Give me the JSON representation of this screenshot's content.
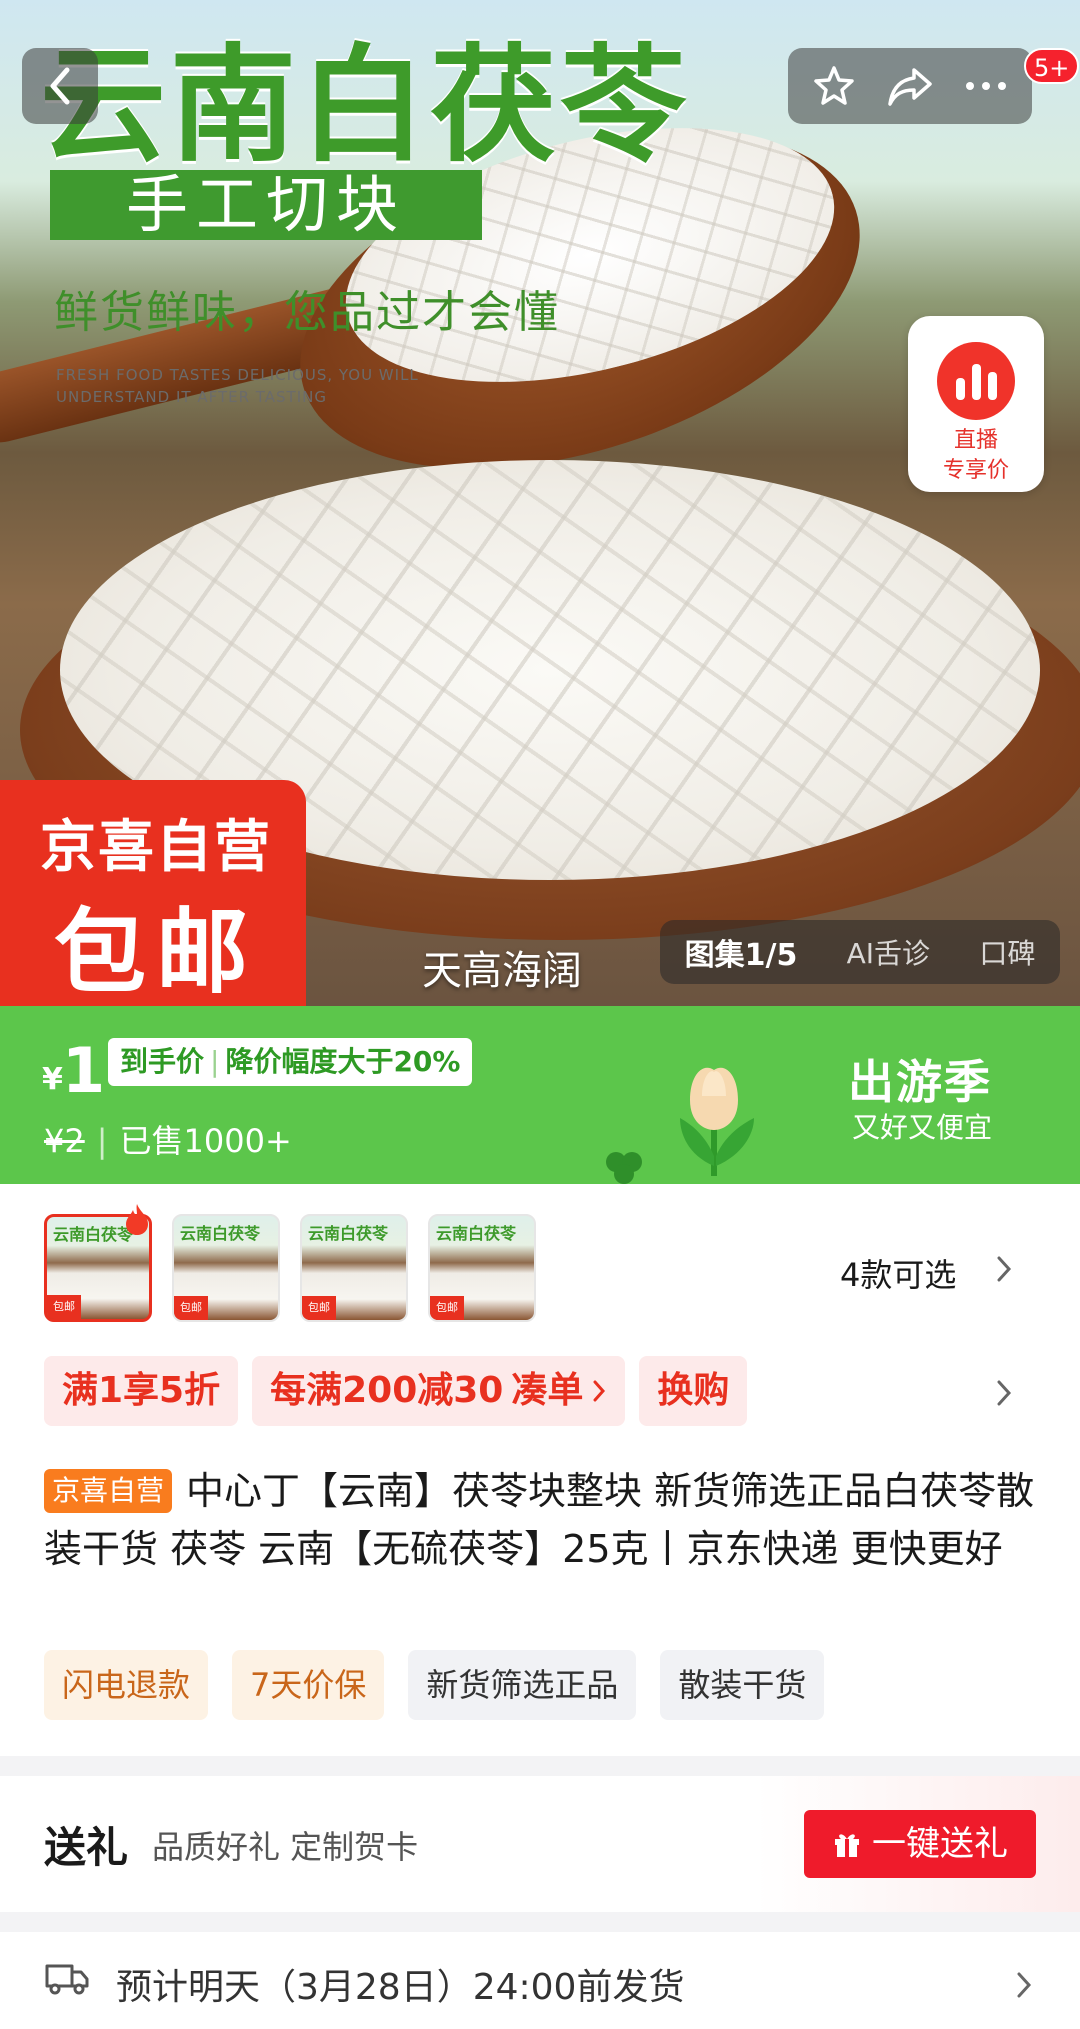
{
  "hero": {
    "title": "云南白茯苓",
    "tag": "手工切块",
    "slogan": "鲜货鲜味，您品过才会懂",
    "english": "FRESH FOOD TASTES DELICIOUS, YOU WILL\nUNDERSTAND IT AFTER TASTING",
    "live_badge_line1": "直播",
    "live_badge_line2": "专享价",
    "promo_line1": "京喜自营",
    "promo_line2": "包邮",
    "caption": "天高海阔",
    "gallery_label": "图集1/5",
    "ai_label": "AI舌诊",
    "reviews_label": "口碑",
    "notification_badge": "5+"
  },
  "price": {
    "currency": "¥",
    "value": "1",
    "pill_main": "到手价",
    "pill_detail": "降价幅度大于20%",
    "original": "¥2",
    "sold": "已售1000+",
    "season_title": "出游季",
    "season_sub": "又好又便宜"
  },
  "thumbs": [
    {
      "title": "云南白茯苓",
      "badge": "包邮"
    },
    {
      "title": "云南白茯苓",
      "badge": "包邮"
    },
    {
      "title": "云南白茯苓",
      "badge": "包邮"
    },
    {
      "title": "云南白茯苓",
      "badge": "包邮"
    }
  ],
  "variants_label": "4款可选",
  "coupons": {
    "c1": "满1享5折",
    "c2_main": "每满200减30",
    "c2_action": "凑单",
    "c3": "换购"
  },
  "product": {
    "store_tag": "京喜自营",
    "title": "中心丁【云南】茯苓块整块 新货筛选正品白茯苓散装干货 茯苓 云南【无硫茯苓】25克丨京东快递 更快更好"
  },
  "service_tags": [
    "闪电退款",
    "7天价保",
    "新货筛选正品",
    "散装干货"
  ],
  "gift": {
    "title": "送礼",
    "subtitle": "品质好礼 定制贺卡",
    "button": "一键送礼"
  },
  "shipping": {
    "text": "预计明天（3月28日）24:00前发货"
  },
  "colors": {
    "accent_red": "#e8301f",
    "price_green": "#5cc64b",
    "store_orange": "#f97c1e"
  }
}
